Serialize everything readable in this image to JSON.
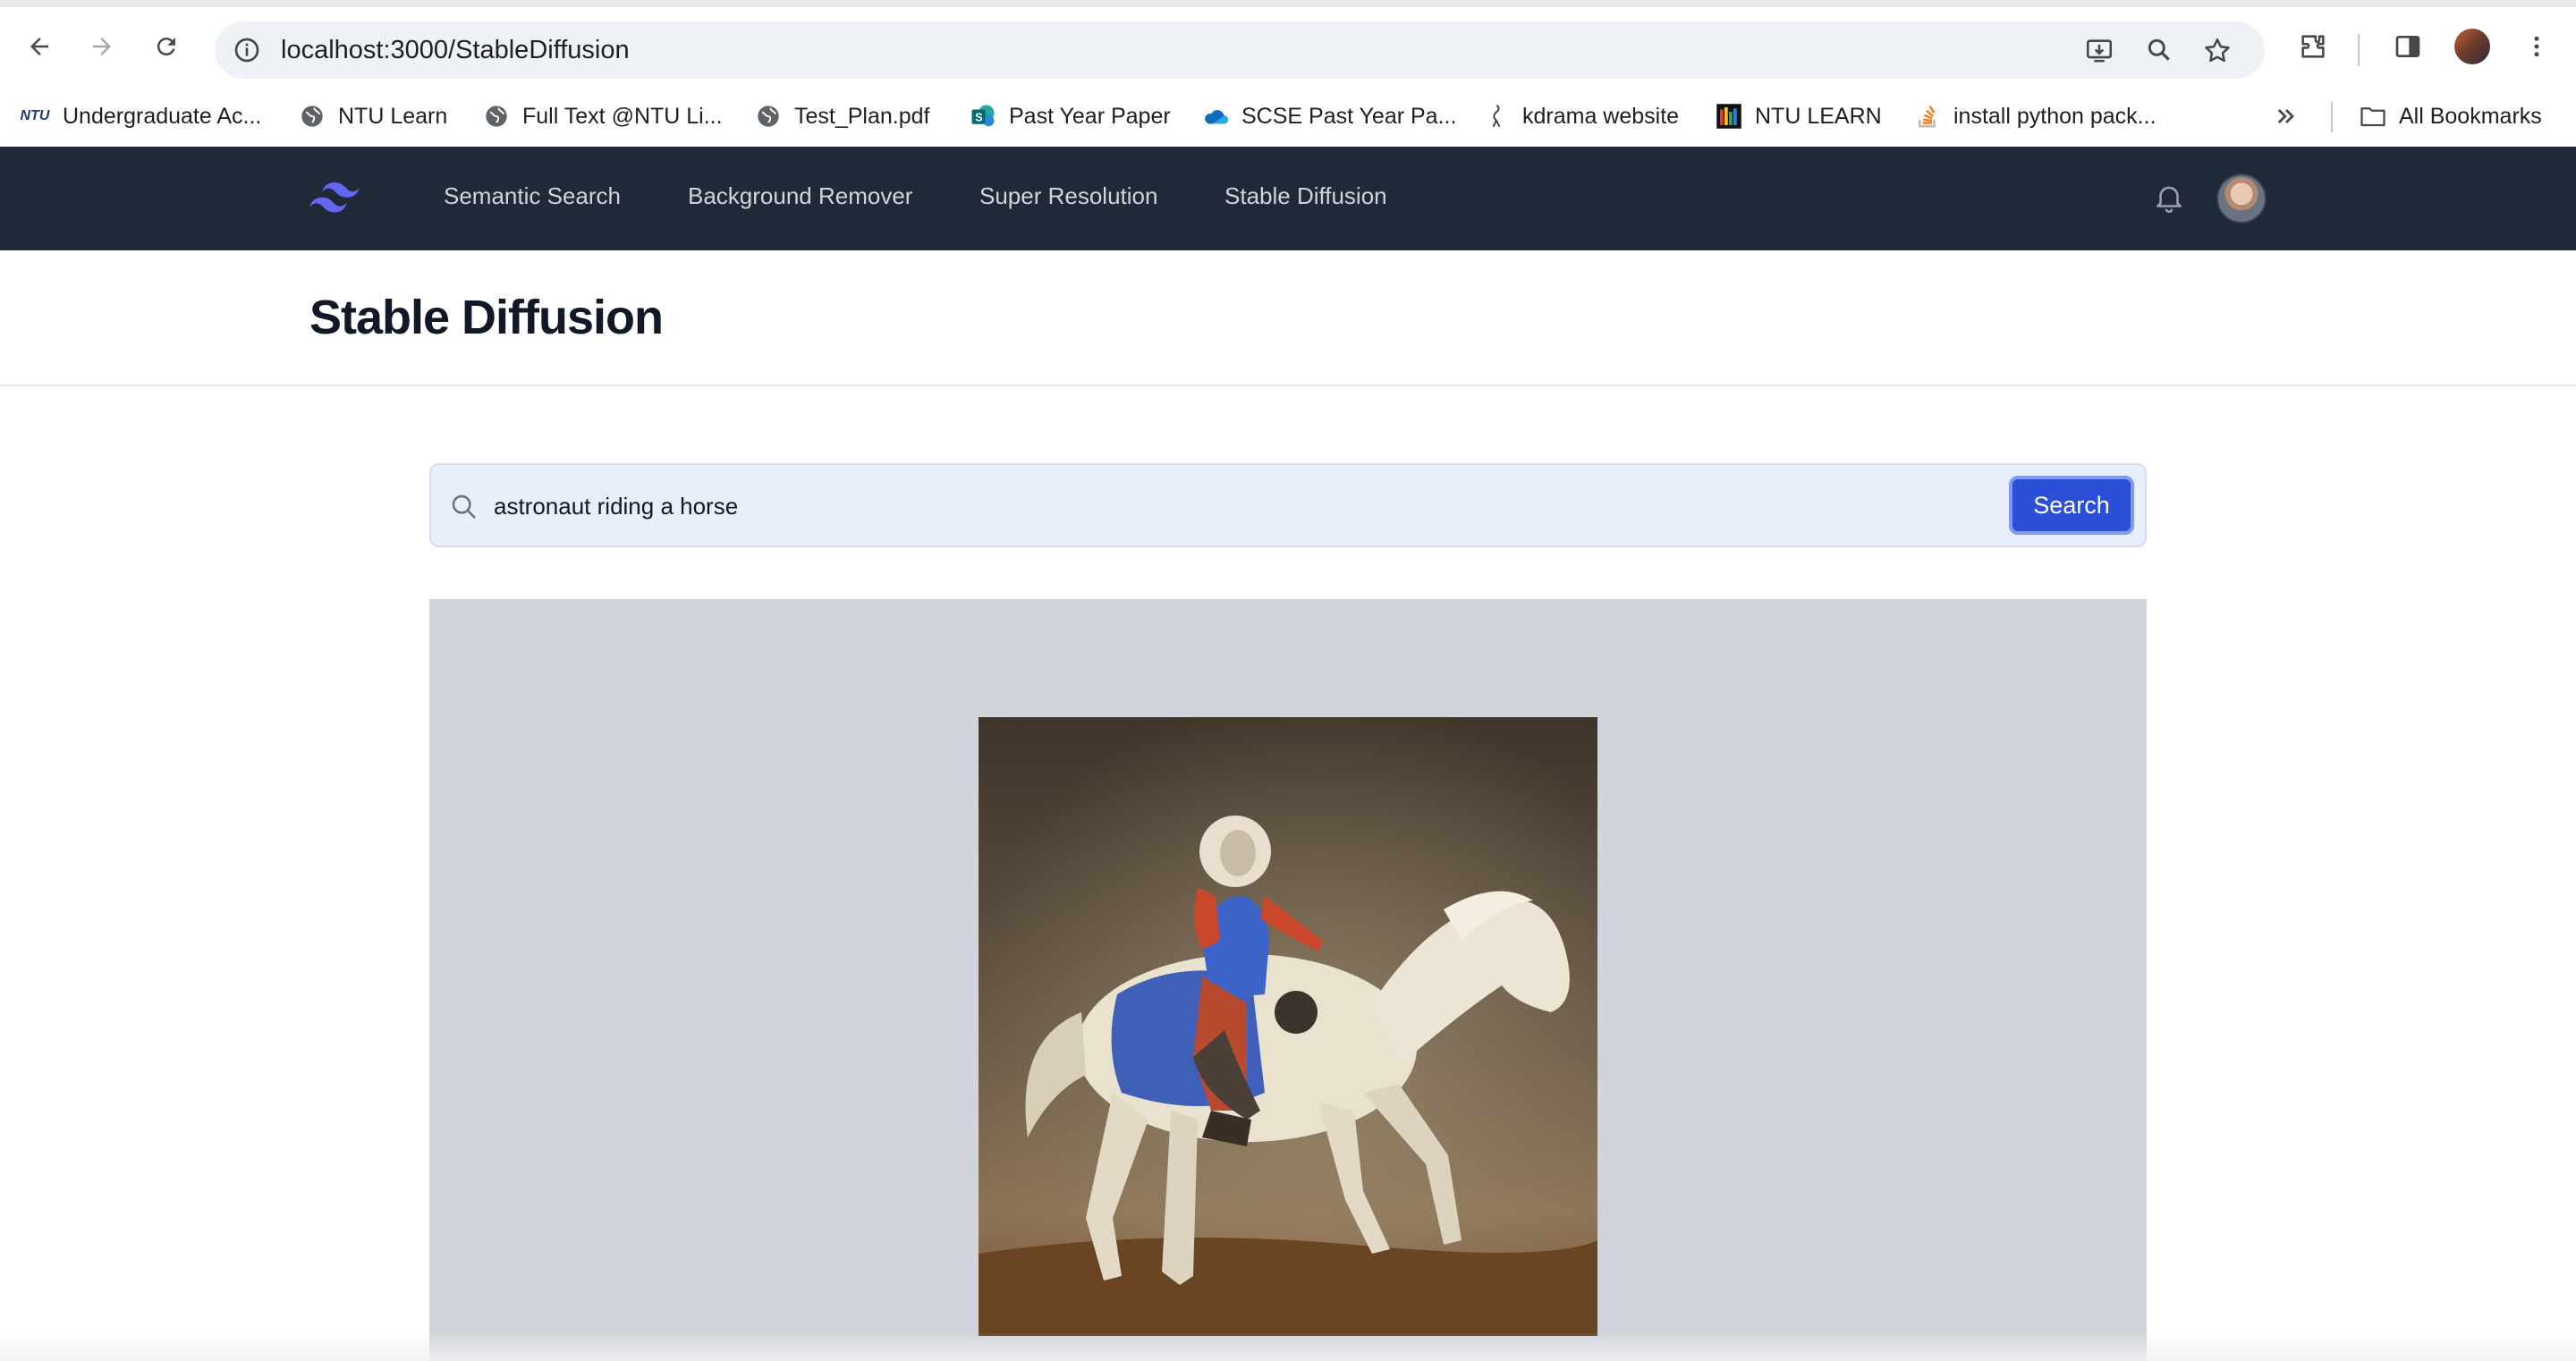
{
  "browser": {
    "url": "localhost:3000/StableDiffusion",
    "bookmarks": [
      {
        "label": "Undergraduate Ac...",
        "icon": "ntu-icon"
      },
      {
        "label": "NTU Learn",
        "icon": "globe-icon"
      },
      {
        "label": "Full Text @NTU Li...",
        "icon": "globe-icon"
      },
      {
        "label": "Test_Plan.pdf",
        "icon": "globe-icon"
      },
      {
        "label": "Past Year Paper",
        "icon": "sharepoint-icon"
      },
      {
        "label": "SCSE Past Year Pa...",
        "icon": "onedrive-icon"
      },
      {
        "label": "kdrama website",
        "icon": "bookmark-icon"
      },
      {
        "label": "NTU LEARN",
        "icon": "ntu-learn-icon"
      },
      {
        "label": "install python pack...",
        "icon": "stackoverflow-icon"
      }
    ],
    "all_bookmarks_label": "All Bookmarks"
  },
  "nav": {
    "links": [
      "Semantic Search",
      "Background Remover",
      "Super Resolution",
      "Stable Diffusion"
    ],
    "accent_color": "#6366f1"
  },
  "page": {
    "title": "Stable Diffusion"
  },
  "search": {
    "value": "astronaut riding a horse",
    "button_label": "Search"
  },
  "colors": {
    "nav_bg": "#1f2937",
    "button_bg": "#2b4fd6",
    "panel_bg": "#d1d5db"
  }
}
